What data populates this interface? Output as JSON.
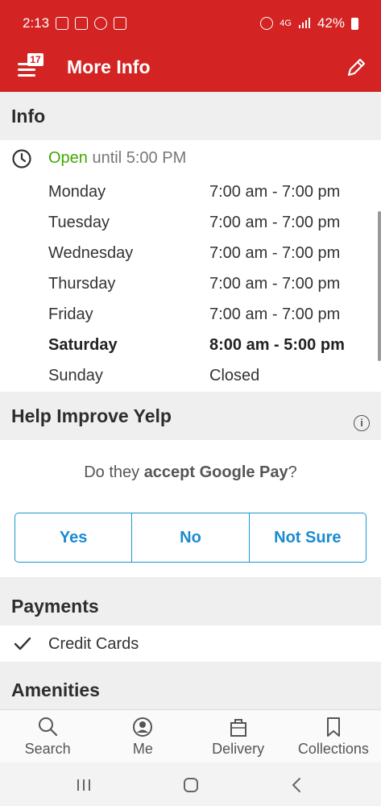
{
  "status_bar": {
    "time": "2:13",
    "battery": "42%",
    "network": "4G"
  },
  "app_bar": {
    "title": "More Info",
    "badge": "17"
  },
  "info": {
    "heading": "Info",
    "open_status": "Open",
    "open_until": "until 5:00 PM",
    "hours": [
      {
        "day": "Monday",
        "time": "7:00 am - 7:00 pm"
      },
      {
        "day": "Tuesday",
        "time": "7:00 am - 7:00 pm"
      },
      {
        "day": "Wednesday",
        "time": "7:00 am - 7:00 pm"
      },
      {
        "day": "Thursday",
        "time": "7:00 am - 7:00 pm"
      },
      {
        "day": "Friday",
        "time": "7:00 am - 7:00 pm"
      },
      {
        "day": "Saturday",
        "time": "8:00 am - 5:00 pm"
      },
      {
        "day": "Sunday",
        "time": "Closed"
      }
    ]
  },
  "help": {
    "heading": "Help Improve Yelp",
    "question_prefix": "Do they ",
    "question_bold": "accept Google Pay",
    "question_suffix": "?",
    "options": [
      "Yes",
      "No",
      "Not Sure"
    ]
  },
  "payments": {
    "heading": "Payments",
    "items": [
      "Credit Cards"
    ]
  },
  "amenities": {
    "heading": "Amenities"
  },
  "bottom_nav": [
    {
      "label": "Search",
      "icon": "search-icon"
    },
    {
      "label": "Me",
      "icon": "profile-icon"
    },
    {
      "label": "Delivery",
      "icon": "delivery-bag-icon"
    },
    {
      "label": "Collections",
      "icon": "bookmark-icon"
    }
  ],
  "colors": {
    "brand": "#d32323",
    "open": "#41a700",
    "accent": "#1996d4"
  }
}
